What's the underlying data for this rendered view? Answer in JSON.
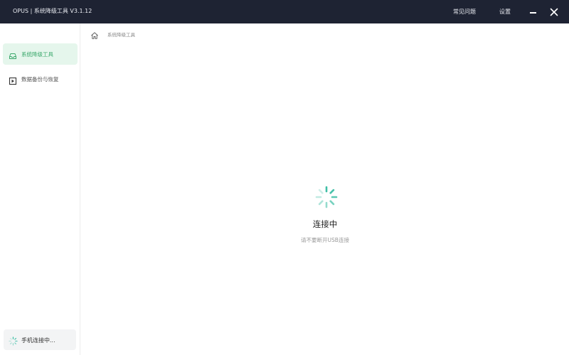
{
  "window": {
    "title": "OPUS | 系统降级工具  V3.1.12",
    "menu_faq": "常见问题",
    "menu_settings": "设置",
    "minimize_icon": "minimize-icon",
    "close_icon": "close-icon"
  },
  "sidebar": {
    "items": [
      {
        "label": "系统降级工具",
        "icon": "inbox-icon",
        "active": true
      },
      {
        "label": "数据备份与恢复",
        "icon": "backup-box-icon",
        "active": false
      }
    ],
    "status": {
      "label": "手机连接中...",
      "icon": "spinner-icon"
    }
  },
  "main": {
    "breadcrumb": {
      "home_icon": "home-icon",
      "current": "系统降级工具"
    },
    "connection": {
      "title": "连接中",
      "subtitle": "请不要断开USB连接",
      "spinner_icon": "loading-spinner-icon"
    }
  },
  "colors": {
    "titlebar_bg": "#1e2333",
    "accent_green": "#3aa86b",
    "active_bg": "#e5f6ec",
    "spinner_teal": "#3fbfa6"
  }
}
